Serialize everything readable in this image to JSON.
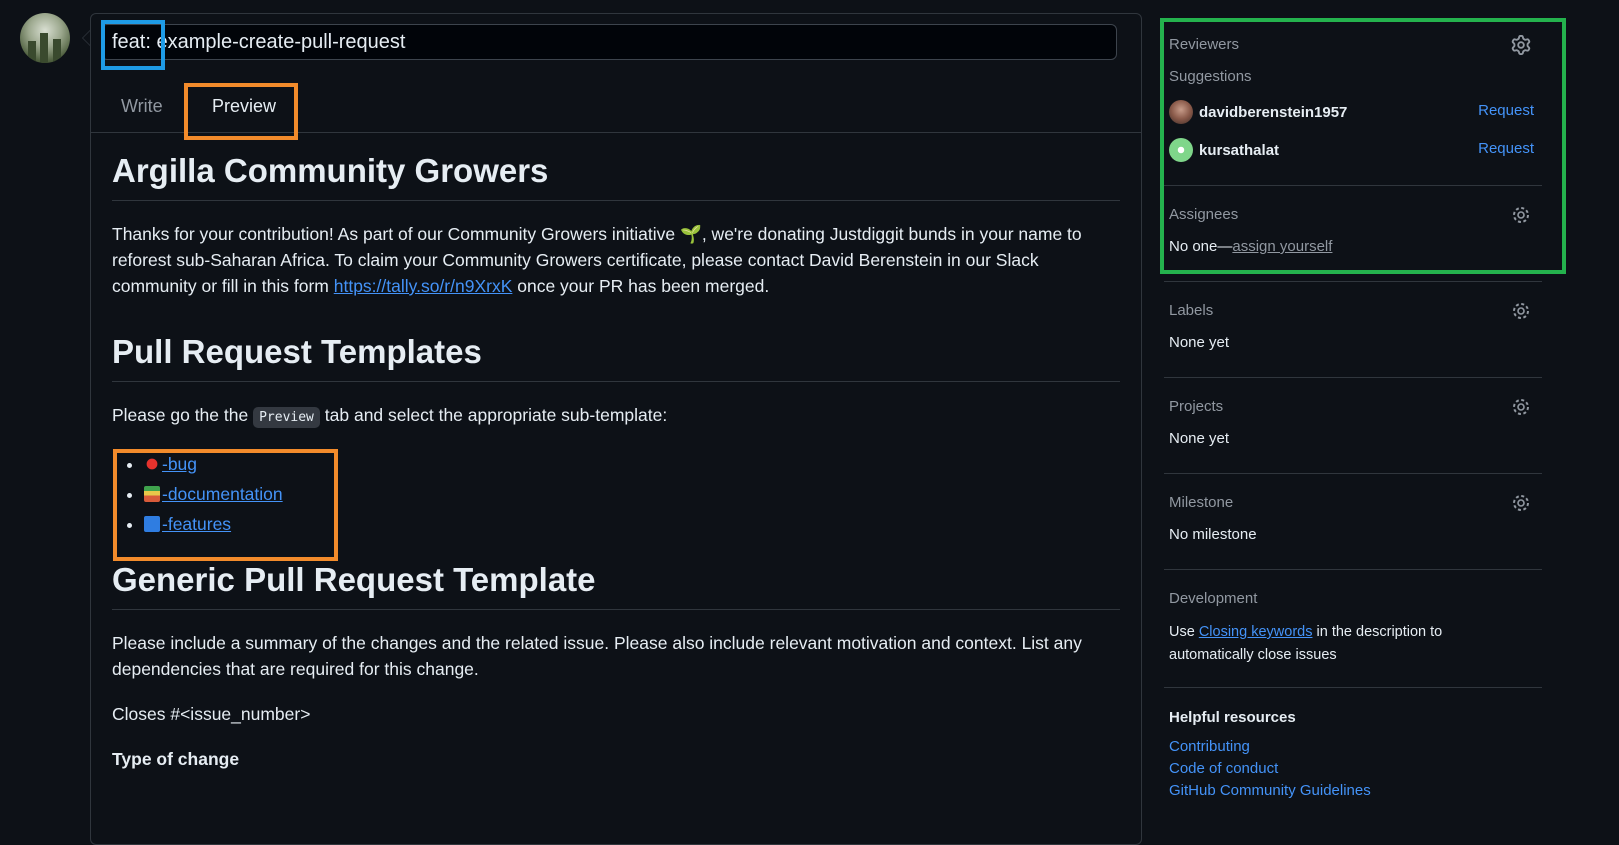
{
  "pr_title": {
    "value": "feat: example-create-pull-request"
  },
  "tabs": {
    "write": "Write",
    "preview": "Preview"
  },
  "preview": {
    "h1_community": "Argilla Community Growers",
    "community_text_1": "Thanks for your contribution! As part of our Community Growers initiative",
    "community_text_2": ", we're donating Justdiggit bunds in your name to reforest sub-Saharan Africa. To claim your Community Growers certificate, please contact David Berenstein in our Slack community or fill in this form",
    "community_link": "https://tally.so/r/n9XrxK",
    "community_text_3": "once your PR has been merged.",
    "h1_templates": "Pull Request Templates",
    "templates_text_1": "Please go the the",
    "templates_code": "Preview",
    "templates_text_2": "tab and select the appropriate sub-template:",
    "template_links": [
      "-bug",
      "-documentation",
      "-features"
    ],
    "h1_generic": "Generic Pull Request Template",
    "generic_text": "Please include a summary of the changes and the related issue. Please also include relevant motivation and context. List any dependencies that are required for this change.",
    "closes_text": "Closes #<issue_number>",
    "type_of_change": "Type of change"
  },
  "sidebar": {
    "reviewers": {
      "title": "Reviewers",
      "suggestions_label": "Suggestions",
      "suggestions": [
        {
          "name": "davidberenstein1957",
          "action": "Request"
        },
        {
          "name": "kursathalat",
          "action": "Request"
        }
      ]
    },
    "assignees": {
      "title": "Assignees",
      "none_text": "No one—",
      "assign_link": "assign yourself"
    },
    "labels": {
      "title": "Labels",
      "value": "None yet"
    },
    "projects": {
      "title": "Projects",
      "value": "None yet"
    },
    "milestone": {
      "title": "Milestone",
      "value": "No milestone"
    },
    "development": {
      "title": "Development",
      "text_1": "Use",
      "link": "Closing keywords",
      "text_2": "in the description to automatically close issues"
    },
    "helpful_resources": {
      "title": "Helpful resources",
      "links": [
        "Contributing",
        "Code of conduct",
        "GitHub Community Guidelines"
      ]
    }
  },
  "colors": {
    "background": "#0d1117",
    "link": "#4493f8",
    "highlight_blue": "#1e9be6",
    "highlight_orange": "#f28b2b",
    "highlight_green": "#24b24d"
  }
}
